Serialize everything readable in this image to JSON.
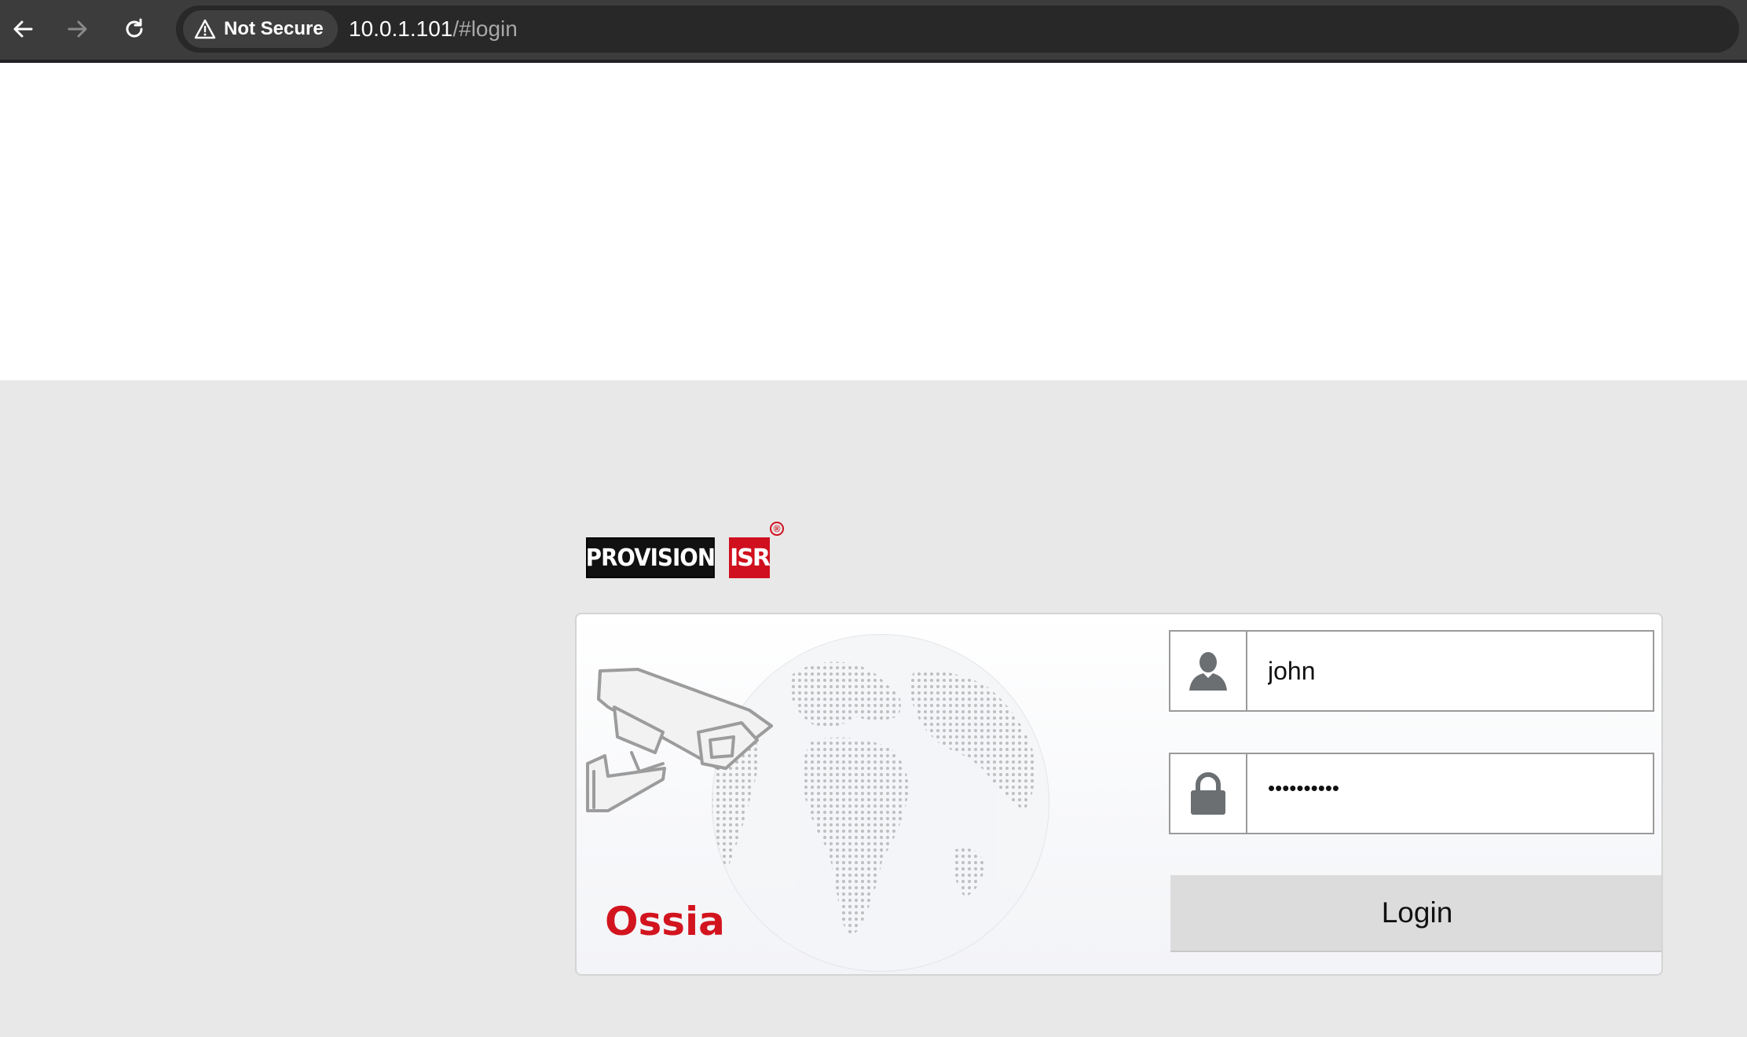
{
  "browser": {
    "security_label": "Not Secure",
    "url_host": "10.0.1.101",
    "url_path": "/#login",
    "icons": {
      "back": "arrow-left-icon",
      "forward": "arrow-right-icon",
      "reload": "reload-icon",
      "security": "warning-triangle-icon"
    }
  },
  "logo": {
    "brand_text": "PROVISION",
    "brand_suffix": "ISR",
    "registered_mark": "®"
  },
  "login": {
    "product_name": "Ossia",
    "username_value": "john",
    "password_value": "••••••••••",
    "button_label": "Login",
    "icons": {
      "username": "user-icon",
      "password": "lock-icon"
    }
  },
  "colors": {
    "browser_bar": "#3c3c3c",
    "omnibox": "#282828",
    "page_background": "#e8e8e8",
    "brand_red": "#d2141e",
    "button_background": "#dcdcdc"
  }
}
